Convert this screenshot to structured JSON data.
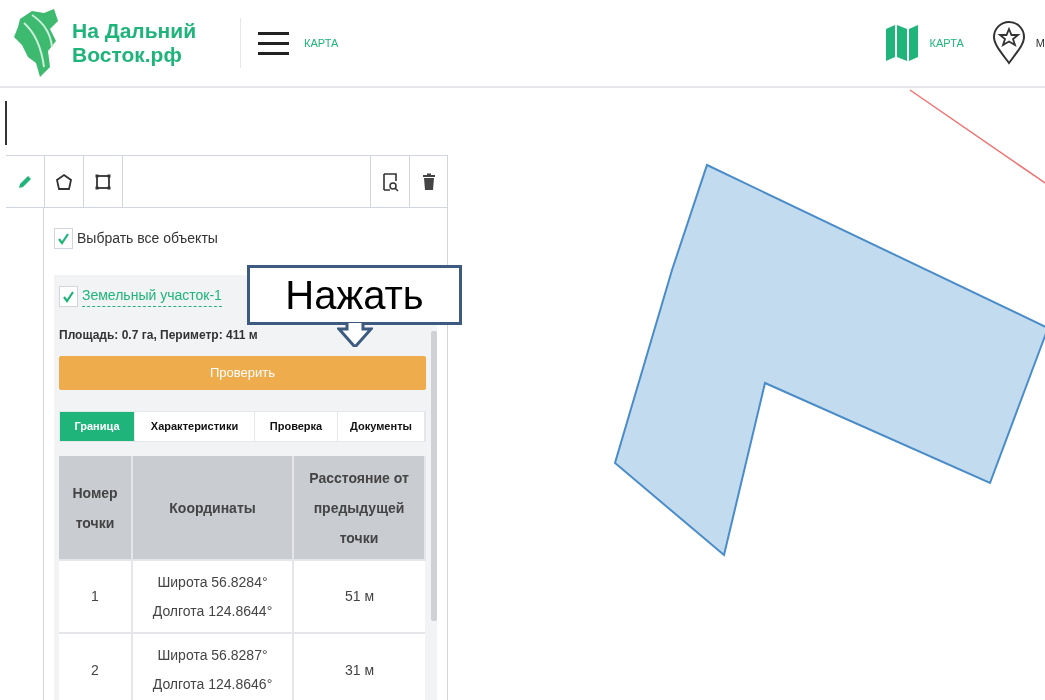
{
  "header": {
    "brand": [
      "На Дальний",
      "Восток.рф"
    ],
    "menu_label": "КАРТА",
    "nav": [
      {
        "kind": "map",
        "label": "КАРТА"
      },
      {
        "kind": "pin",
        "label": "М"
      }
    ]
  },
  "toolbar": {
    "tools": [
      {
        "kind": "pencil",
        "selected": true
      },
      {
        "kind": "polygon",
        "selected": false
      },
      {
        "kind": "rectangle",
        "selected": false
      }
    ]
  },
  "select_all": {
    "label": "Выбрать все объекты",
    "checked": true
  },
  "object": {
    "name": "Земельный участок-1",
    "checked": true,
    "stats": "Площадь: 0.7 га, Периметр: 411 м",
    "button": "Проверить",
    "tabs": [
      {
        "label": "Граница",
        "selected": true
      },
      {
        "label": "Характеристики",
        "selected": false
      },
      {
        "label": "Проверка",
        "selected": false
      },
      {
        "label": "Документы",
        "selected": false
      }
    ],
    "table": {
      "columns": [
        "Номер точки",
        "Координаты",
        "Расстояние от предыдущей точки"
      ],
      "rows": [
        {
          "number": "1",
          "coordinates": [
            "Широта 56.8284°",
            "Долгота 124.8644°"
          ],
          "distance": "51 м"
        },
        {
          "number": "2",
          "coordinates": [
            "Широта 56.8287°",
            "Долгота 124.8646°"
          ],
          "distance": "31 м"
        }
      ]
    }
  },
  "callout": {
    "text": "Нажать"
  }
}
